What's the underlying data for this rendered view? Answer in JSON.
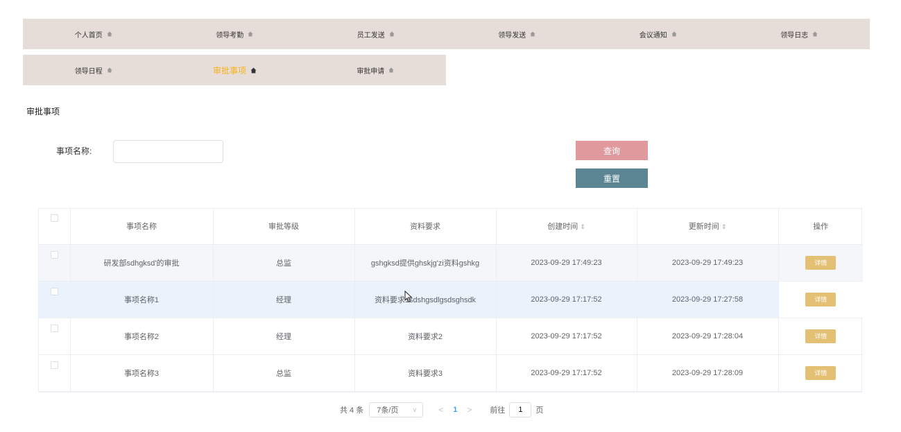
{
  "nav": {
    "row1": [
      {
        "label": "个人首页"
      },
      {
        "label": "领导考勤"
      },
      {
        "label": "员工发送"
      },
      {
        "label": "领导发送"
      },
      {
        "label": "会议通知"
      },
      {
        "label": "领导日志"
      }
    ],
    "row2": [
      {
        "label": "领导日程"
      },
      {
        "label": "审批事项",
        "active": true
      },
      {
        "label": "审批申请"
      }
    ],
    "active_color": "#f7b21c",
    "bar_color": "#e6ddd8"
  },
  "page_title": "审批事项",
  "search": {
    "label": "事项名称:",
    "value": "",
    "placeholder": "",
    "query_label": "查询",
    "reset_label": "重置",
    "query_color": "#e09a9e",
    "reset_color": "#5b8592"
  },
  "table": {
    "headers": {
      "name": "事项名称",
      "level": "审批等级",
      "requirement": "资料要求",
      "created": "创建时间",
      "updated": "更新时间",
      "action": "操作"
    },
    "sort_icon": "⇕",
    "rows": [
      {
        "name": "研发部sdhgksd'的审批",
        "level": "总监",
        "requirement": "gshgksd提供ghskjg'zi资料gshkg",
        "created": "2023-09-29 17:49:23",
        "updated": "2023-09-29 17:49:23",
        "action": "详情"
      },
      {
        "name": "事项名称1",
        "level": "经理",
        "requirement": "资料要求1sdshgsdlgsdsghsdk",
        "created": "2023-09-29 17:17:52",
        "updated": "2023-09-29 17:27:58",
        "action": "详情"
      },
      {
        "name": "事项名称2",
        "level": "经理",
        "requirement": "资料要求2",
        "created": "2023-09-29 17:17:52",
        "updated": "2023-09-29 17:28:04",
        "action": "详情"
      },
      {
        "name": "事项名称3",
        "level": "总监",
        "requirement": "资料要求3",
        "created": "2023-09-29 17:17:52",
        "updated": "2023-09-29 17:28:09",
        "action": "详情"
      }
    ],
    "detail_color": "#e3c073"
  },
  "pagination": {
    "total": "共 4 条",
    "page_size": "7条/页",
    "prev": "<",
    "next": ">",
    "current_page": "1",
    "goto_label": "前往",
    "goto_value": "1",
    "page_unit": "页"
  }
}
